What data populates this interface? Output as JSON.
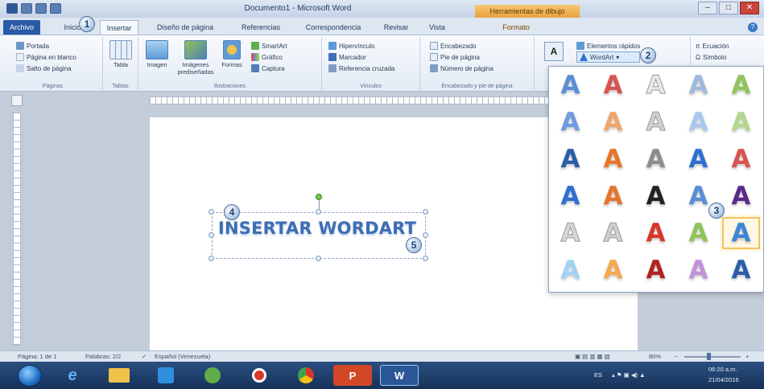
{
  "titlebar": {
    "doc_title": "Documento1 - Microsoft Word",
    "context_tab": "Herramientas de dibujo"
  },
  "tabs": [
    {
      "label": "Archivo"
    },
    {
      "label": "Inicio"
    },
    {
      "label": "Insertar"
    },
    {
      "label": "Diseño de página"
    },
    {
      "label": "Referencias"
    },
    {
      "label": "Correspondencia"
    },
    {
      "label": "Revisar"
    },
    {
      "label": "Vista"
    },
    {
      "label": "Formato"
    }
  ],
  "ribbon": {
    "paginas": {
      "label": "Páginas",
      "items": [
        "Portada",
        "Página en blanco",
        "Salto de página"
      ]
    },
    "tablas": {
      "label": "Tablas",
      "items": [
        "Tabla"
      ]
    },
    "ilustraciones": {
      "label": "Ilustraciones",
      "big": [
        "Imagen",
        "Imágenes prediseñadas",
        "Formas"
      ],
      "items": [
        "SmartArt",
        "Gráfico",
        "Captura"
      ]
    },
    "vinculos": {
      "label": "Vínculos",
      "items": [
        "Hipervínculo",
        "Marcador",
        "Referencia cruzada"
      ]
    },
    "encabezado": {
      "label": "Encabezado y pie de página",
      "items": [
        "Encabezado",
        "Pie de página",
        "Número de página"
      ]
    },
    "texto": {
      "items": [
        "Elementos rápidos",
        "WordArt"
      ]
    },
    "simbolos": {
      "items": [
        "Ecuación",
        "Símbolo"
      ]
    }
  },
  "document": {
    "wordart_text": "INSERTAR WORDART"
  },
  "badges": [
    "1",
    "2",
    "3",
    "4",
    "5"
  ],
  "gallery": {
    "glyph": "A",
    "rows": [
      [
        "#5b8dd6",
        "#d9534f",
        "#e8e8e8",
        "#9fb8de",
        "#8fc45a"
      ],
      [
        "#6f9be0",
        "#f1a66a",
        "#cfcfcf",
        "#a7c7ef",
        "#b3d88b"
      ],
      [
        "#2c5ea8",
        "#e6752b",
        "#8c8c8c",
        "#2f6fd0",
        "#d9534f"
      ],
      [
        "#2f6fd0",
        "#e6752b",
        "#222222",
        "#5b8dd6",
        "#5a2a8a"
      ],
      [
        "#d6d6d6",
        "#cfcfcf",
        "#d9362b",
        "#8fc45a",
        "#3a86d8"
      ],
      [
        "#9fd3f5",
        "#f4a94e",
        "#b22222",
        "#c291dc",
        "#2c5ea8"
      ]
    ]
  },
  "statusbar": {
    "page": "Página: 1 de 1",
    "words": "Palabras: 2/2",
    "language": "Español (Venezuela)",
    "zoom": "80%"
  },
  "taskbar": {
    "apps": [
      "Internet Explorer",
      "Explorador",
      "Reproductor",
      "Aplicación",
      "Grabador",
      "Chrome",
      "PowerPoint",
      "Word"
    ],
    "lang": "ES",
    "time": "06:20 a.m.",
    "date": "21/04/2016"
  }
}
